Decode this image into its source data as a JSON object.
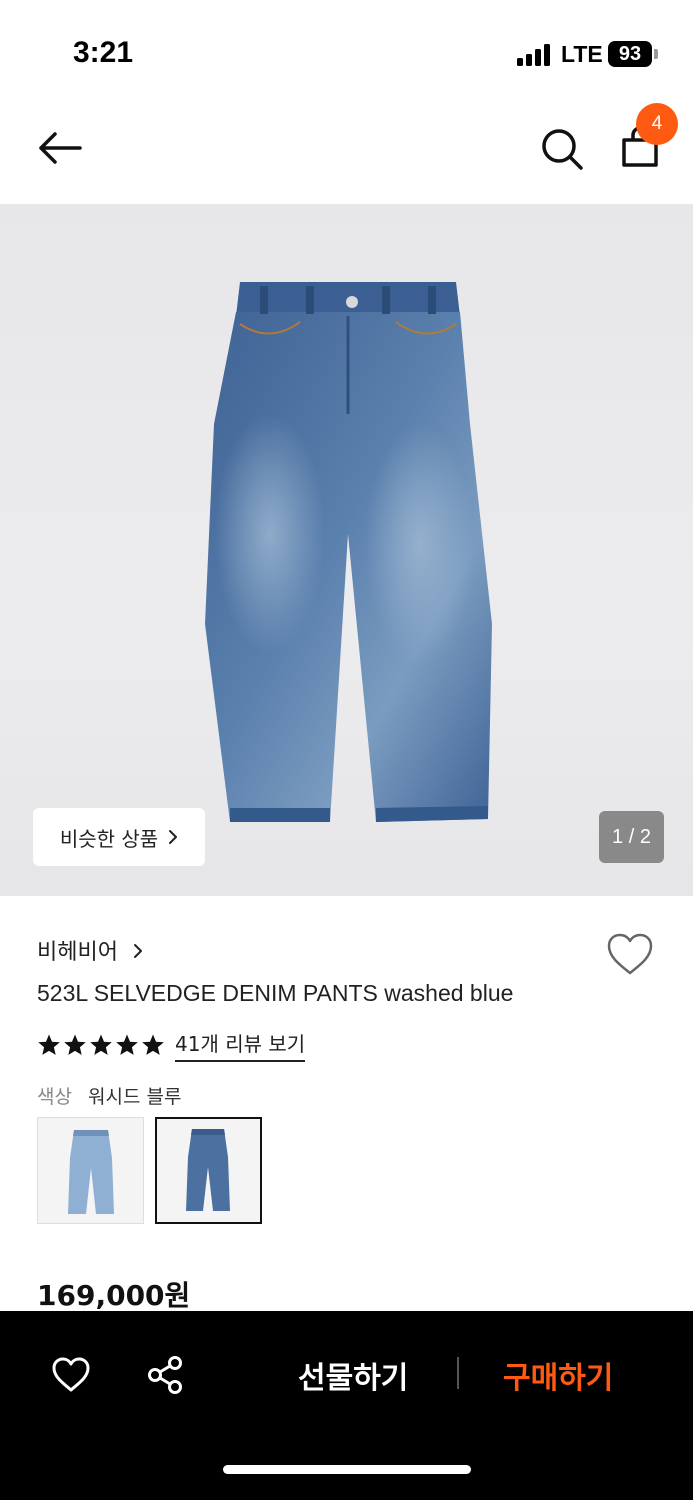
{
  "status_bar": {
    "time": "3:21",
    "network": "LTE",
    "battery": "93"
  },
  "header": {
    "cart_count": "4"
  },
  "gallery": {
    "similar_label": "비슷한 상품",
    "page_indicator": "1 / 2"
  },
  "product": {
    "brand": "비헤비어",
    "name": "523L SELVEDGE DENIM PANTS washed blue",
    "rating": 5,
    "review_link": "41개 리뷰 보기",
    "color_label": "색상",
    "color_value": "워시드 블루",
    "price": "169,000원"
  },
  "bottom_bar": {
    "gift_label": "선물하기",
    "buy_label": "구매하기"
  },
  "colors": {
    "accent": "#ff5a12",
    "denim": "#4a6e9e"
  }
}
